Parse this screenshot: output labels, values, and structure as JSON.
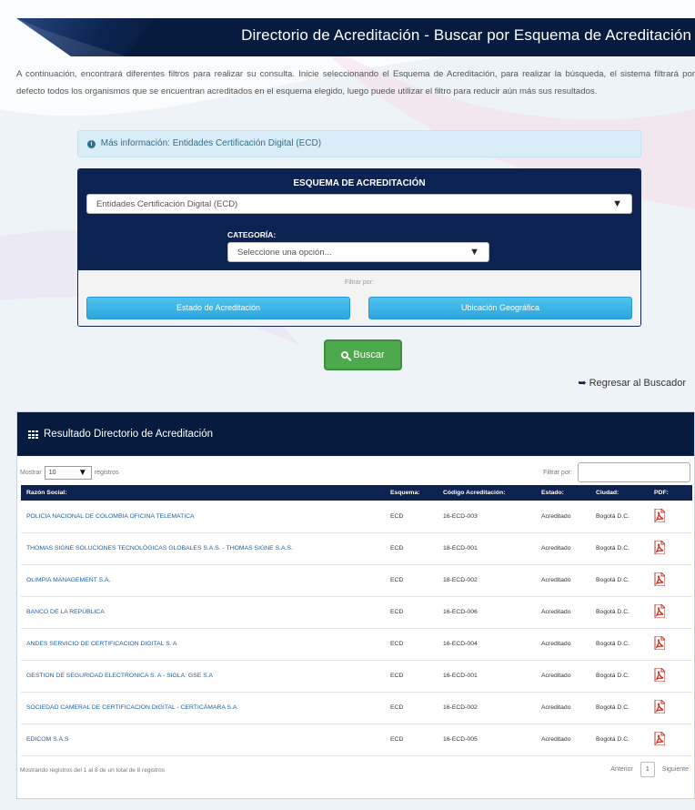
{
  "header": {
    "title": "Directorio de Acreditación - Buscar por Esquema de Acreditación"
  },
  "intro_text": "A continuación, encontrará diferentes filtros para realizar su consulta. Inicie seleccionando el Esquema de Acreditación, para realizar la búsqueda, el sistema filtrará por defecto todos los organismos que se encuentran acreditados en el esquema elegido, luego puede utilizar el filtro para reducir aún más sus resultados.",
  "info_alert": {
    "icon": "info-circle-icon",
    "text": "Más información: Entidades Certificación Digital (ECD)"
  },
  "filters": {
    "scheme_label": "ESQUEMA DE ACREDITACIÓN",
    "scheme_selected": "Entidades Certificación Digital (ECD)",
    "category_label": "CATEGORÍA:",
    "category_selected": "Seleccione una opción...",
    "filter_by_label": "Filtrar por:",
    "state_button": "Estado de Acreditación",
    "location_button": "Ubicación Geográfica"
  },
  "search_button": "Buscar",
  "back_link": "Regresar al Buscador",
  "results": {
    "title": "Resultado Directorio de Acreditación",
    "length_prefix": "Mostrar",
    "length_value": "10",
    "length_suffix": "registros",
    "filter_label": "Filtrar por:",
    "columns": [
      "Razón Social:",
      "Esquema:",
      "Código Acreditación:",
      "Estado:",
      "Ciudad:",
      "PDF:"
    ],
    "rows": [
      [
        "POLICIA NACIONAL DE COLOMBIA OFICINA TELEMATICA",
        "ECD",
        "16-ECD-003",
        "Acreditado",
        "Bogotá D.C."
      ],
      [
        "THOMAS SIGNE SOLUCIONES TECNOLÓGICAS GLOBALES S.A.S. - THOMAS SIGNE S.A.S.",
        "ECD",
        "18-ECD-001",
        "Acreditado",
        "Bogotá D.C."
      ],
      [
        "OLIMPIA MANAGEMENT S.A.",
        "ECD",
        "18-ECD-002",
        "Acreditado",
        "Bogotá D.C."
      ],
      [
        "BANCO DE LA REPÚBLICA",
        "ECD",
        "16-ECD-006",
        "Acreditado",
        "Bogotá D.C."
      ],
      [
        "ANDES SERVICIO DE CERTIFICACION DIGITAL S. A",
        "ECD",
        "16-ECD-004",
        "Acreditado",
        "Bogotá D.C."
      ],
      [
        "GESTION DE SEGURIDAD ELECTRONICA S. A - SIGLA: GSE S.A",
        "ECD",
        "16-ECD-001",
        "Acreditado",
        "Bogotá D.C."
      ],
      [
        "SOCIEDAD CAMERAL DE CERTIFICACION DIGITAL - CERTICÁMARA S.A.",
        "ECD",
        "16-ECD-002",
        "Acreditado",
        "Bogotá D.C."
      ],
      [
        "EDICOM S.A.S",
        "ECD",
        "16-ECD-005",
        "Acreditado",
        "Bogotá D.C."
      ]
    ],
    "info": "Mostrando registros del 1 al 8 de un total de 8 registros",
    "prev": "Anterior",
    "page": "1",
    "next": "Siguiente"
  }
}
